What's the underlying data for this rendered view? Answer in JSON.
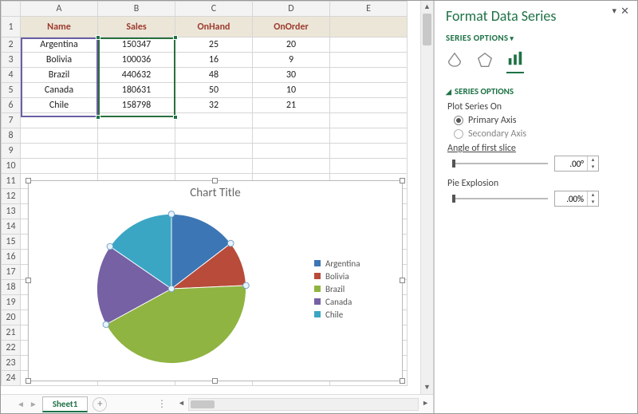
{
  "columns": [
    "A",
    "B",
    "C",
    "D",
    "E"
  ],
  "rows_visible": 24,
  "table": {
    "headers": [
      "Name",
      "Sales",
      "OnHand",
      "OnOrder"
    ],
    "rows": [
      {
        "name": "Argentina",
        "sales": "150347",
        "onhand": "25",
        "onorder": "20"
      },
      {
        "name": "Bolivia",
        "sales": "100036",
        "onhand": "16",
        "onorder": "9"
      },
      {
        "name": "Brazil",
        "sales": "440632",
        "onhand": "48",
        "onorder": "30"
      },
      {
        "name": "Canada",
        "sales": "180631",
        "onhand": "50",
        "onorder": "10"
      },
      {
        "name": "Chile",
        "sales": "158798",
        "onhand": "32",
        "onorder": "21"
      }
    ]
  },
  "chart_data": {
    "type": "pie",
    "title": "Chart Title",
    "categories": [
      "Argentina",
      "Bolivia",
      "Brazil",
      "Canada",
      "Chile"
    ],
    "values": [
      150347,
      100036,
      440632,
      180631,
      158798
    ],
    "colors": [
      "#3d76b4",
      "#b84b3a",
      "#8fb441",
      "#7561a4",
      "#3aa6c4"
    ],
    "legend_position": "right"
  },
  "sheet_tab": "Sheet1",
  "panel": {
    "title": "Format Data Series",
    "menu": "SERIES OPTIONS",
    "section": "SERIES OPTIONS",
    "plot_label": "Plot Series On",
    "primary": "Primary Axis",
    "secondary": "Secondary Axis",
    "angle_label": "Angle of first slice",
    "angle_value": ".00°",
    "explode_label": "Pie Explosion",
    "explode_value": ".00%"
  }
}
